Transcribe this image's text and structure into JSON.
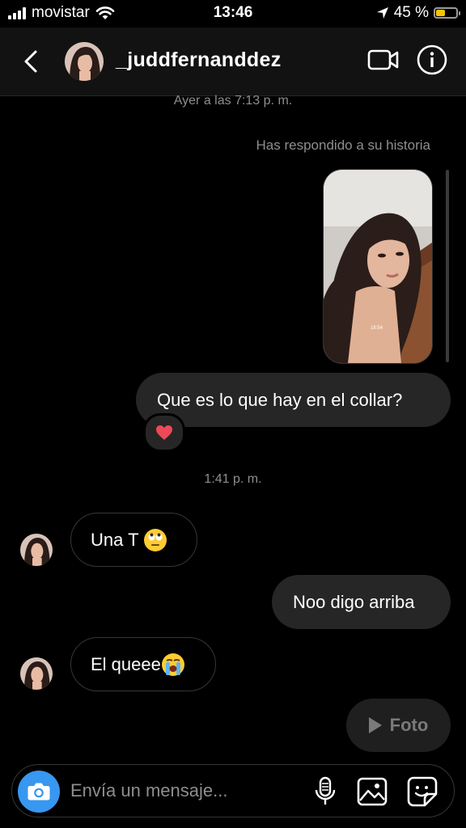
{
  "status_bar": {
    "carrier": "movistar",
    "time": "13:46",
    "battery": "45 %",
    "battery_level": 0.45,
    "battery_color": "#f5c400",
    "icons": [
      "signal-bars-icon",
      "wifi-icon",
      "location-arrow-icon",
      "battery-icon"
    ]
  },
  "header": {
    "back_icon": "chevron-left-icon",
    "username": "_juddfernanddez",
    "video_icon": "video-camera-icon",
    "info_icon": "info-icon"
  },
  "conversation": {
    "timestamp_top": "Ayer a las 7:13 p. m.",
    "story_reply_label": "Has respondido a su historia",
    "story_time": "18:54",
    "sent_1": "Que es lo que hay en el collar?",
    "reaction_icon": "heart-icon",
    "timestamp_mid": "1:41 p. m.",
    "recv_1": "Una T",
    "recv_1_emoji": "face-with-rolling-eyes",
    "sent_2": "Noo digo arriba",
    "recv_2": "El queee",
    "recv_2_emoji": "loudly-crying-face"
  },
  "foto_button": {
    "label": "Foto",
    "icon": "play-icon"
  },
  "composer": {
    "placeholder": "Envía un mensaje...",
    "camera_icon": "camera-icon",
    "mic_icon": "microphone-icon",
    "gallery_icon": "gallery-icon",
    "sticker_icon": "sticker-icon"
  },
  "colors": {
    "accent": "#3897f0",
    "sent_bubble": "#262626",
    "heart": "#ed4956",
    "muted_text": "#8e8e8e"
  }
}
